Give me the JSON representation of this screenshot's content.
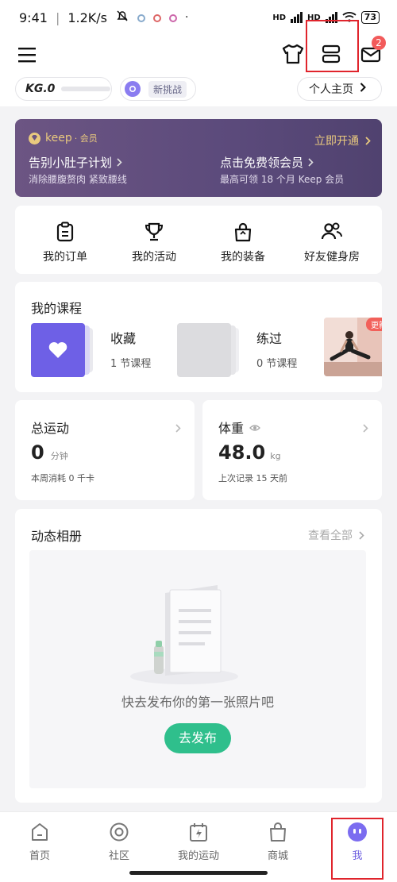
{
  "status_bar": {
    "time": "9:41",
    "speed": "1.2K/s",
    "battery": "73",
    "hd1": "HD",
    "hd2": "HD"
  },
  "top_bar": {
    "message_badge": "2"
  },
  "profile": {
    "level": "KG.0",
    "challenge": "新挑战",
    "home_link": "个人主页"
  },
  "vip_banner": {
    "brand": "keep",
    "brand_suffix": "· 会员",
    "open_now": "立即开通",
    "left_title": "告别小肚子计划",
    "left_subtitle": "消除腰腹赘肉 紧致腰线",
    "right_title": "点击免费领会员",
    "right_subtitle": "最高可领 18 个月 Keep 会员"
  },
  "quick_menu": [
    {
      "label": "我的订单",
      "icon": "clipboard-icon"
    },
    {
      "label": "我的活动",
      "icon": "trophy-icon"
    },
    {
      "label": "我的装备",
      "icon": "bag-icon"
    },
    {
      "label": "好友健身房",
      "icon": "friends-icon"
    }
  ],
  "courses": {
    "title": "我的课程",
    "items": [
      {
        "name": "收藏",
        "count": "1 节课程"
      },
      {
        "name": "练过",
        "count": "0 节课程"
      }
    ],
    "more_badge": "更新"
  },
  "stats": {
    "total_title": "总运动",
    "total_value": "0",
    "total_unit": "分钟",
    "total_note": "本周消耗 0 千卡",
    "weight_title": "体重",
    "weight_value": "48.0",
    "weight_unit": "kg",
    "weight_note": "上次记录 15 天前"
  },
  "album": {
    "title": "动态相册",
    "view_all": "查看全部",
    "empty_text": "快去发布你的第一张照片吧",
    "publish_button": "去发布"
  },
  "bottom_nav": [
    {
      "label": "首页",
      "icon": "home-icon"
    },
    {
      "label": "社区",
      "icon": "community-icon"
    },
    {
      "label": "我的运动",
      "icon": "calendar-bolt-icon"
    },
    {
      "label": "商城",
      "icon": "shopping-bag-icon"
    },
    {
      "label": "我",
      "icon": "avatar-icon"
    }
  ],
  "colors": {
    "accent_green": "#2fbf8c",
    "vip_purple": "#5e4b7c",
    "highlight_red": "#e0242c",
    "avatar_purple": "#7b6cf0"
  }
}
